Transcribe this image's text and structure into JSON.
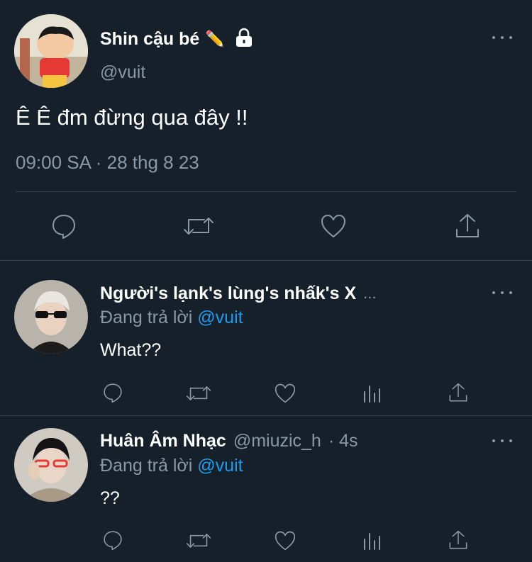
{
  "main_tweet": {
    "display_name": "Shin cậu bé",
    "name_emoji": "✏️",
    "handle": "@vuit",
    "text": "Ê Ê đm đừng qua đây !!",
    "timestamp": "09:00 SA · 28 thg 8 23",
    "icons": [
      "reply-icon",
      "retweet-icon",
      "like-icon",
      "share-icon"
    ]
  },
  "replies": [
    {
      "display_name": "Người's lạnk's lùng's nhấk's X",
      "name_ellipsis": "...",
      "replying_prefix": "Đang trả lời",
      "replying_to": "@vuit",
      "text": "What??"
    },
    {
      "display_name": "Huân Âm Nhạc",
      "handle": "@miuzic_h",
      "time": "· 4s",
      "replying_prefix": "Đang trả lời",
      "replying_to": "@vuit",
      "text": "??"
    }
  ],
  "colors": {
    "background": "#15202b",
    "muted": "#8b98a5",
    "link": "#1d9bf0",
    "divider": "#38444d"
  }
}
